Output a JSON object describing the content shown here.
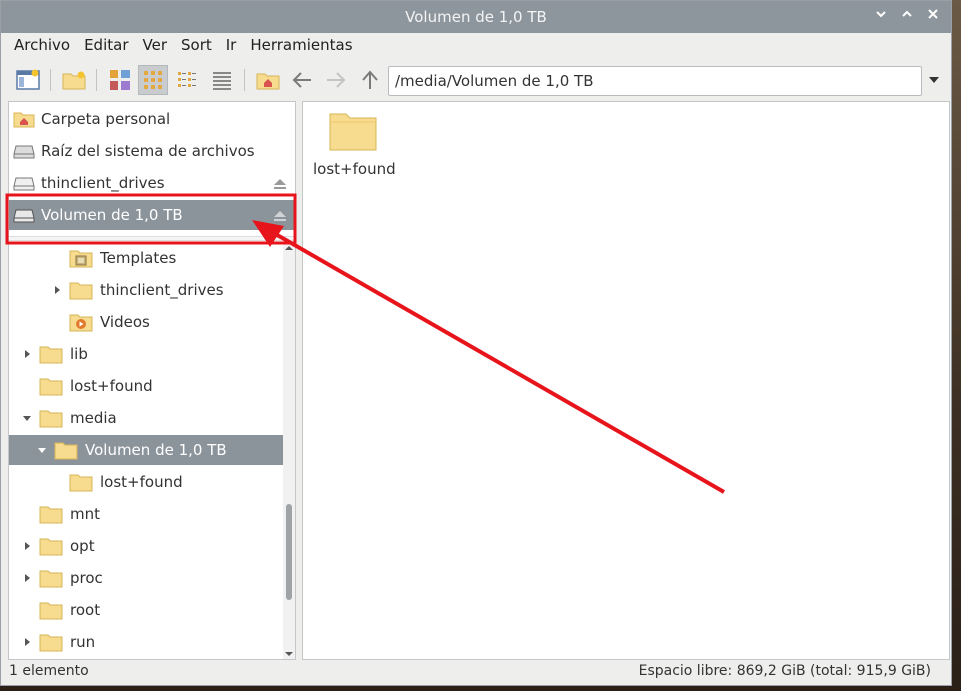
{
  "window": {
    "title": "Volumen de 1,0 TB",
    "controls": [
      "minimize",
      "maximize",
      "close"
    ]
  },
  "menubar": {
    "items": [
      "Archivo",
      "Editar",
      "Ver",
      "Sort",
      "Ir",
      "Herramientas"
    ]
  },
  "toolbar": {
    "path": "/media/Volumen de 1,0 TB",
    "buttons": [
      {
        "icon": "new-window-icon"
      },
      {
        "icon": "new-folder-icon"
      },
      {
        "icon": "thumbnail-view-icon"
      },
      {
        "icon": "icon-view-icon",
        "active": true
      },
      {
        "icon": "compact-view-icon"
      },
      {
        "icon": "list-view-icon"
      },
      {
        "icon": "home-icon"
      },
      {
        "icon": "back-arrow-icon"
      },
      {
        "icon": "forward-arrow-icon"
      },
      {
        "icon": "up-arrow-icon"
      }
    ]
  },
  "places": [
    {
      "label": "Carpeta personal",
      "icon": "home-folder-icon"
    },
    {
      "label": "Raíz del sistema de archivos",
      "icon": "drive-icon"
    },
    {
      "label": "thinclient_drives",
      "icon": "drive-icon",
      "eject": true
    },
    {
      "label": "Volumen de 1,0 TB",
      "icon": "drive-icon",
      "eject": true,
      "selected": true
    }
  ],
  "tree": [
    {
      "label": "Templates",
      "level": 2,
      "expander": "none",
      "icon": "templates-folder-icon"
    },
    {
      "label": "thinclient_drives",
      "level": 2,
      "expander": "collapsed",
      "icon": "folder-icon"
    },
    {
      "label": "Videos",
      "level": 2,
      "expander": "none",
      "icon": "videos-folder-icon"
    },
    {
      "label": "lib",
      "level": 0,
      "expander": "collapsed",
      "icon": "folder-icon"
    },
    {
      "label": "lost+found",
      "level": 0,
      "expander": "none",
      "icon": "folder-icon"
    },
    {
      "label": "media",
      "level": 0,
      "expander": "expanded",
      "icon": "folder-icon"
    },
    {
      "label": "Volumen de 1,0 TB",
      "level": 1,
      "expander": "expanded",
      "icon": "folder-icon",
      "selected": true
    },
    {
      "label": "lost+found",
      "level": 2,
      "expander": "none",
      "icon": "folder-icon"
    },
    {
      "label": "mnt",
      "level": 0,
      "expander": "none",
      "icon": "folder-icon"
    },
    {
      "label": "opt",
      "level": 0,
      "expander": "collapsed",
      "icon": "folder-icon"
    },
    {
      "label": "proc",
      "level": 0,
      "expander": "collapsed",
      "icon": "folder-icon"
    },
    {
      "label": "root",
      "level": 0,
      "expander": "none",
      "icon": "folder-icon"
    },
    {
      "label": "run",
      "level": 0,
      "expander": "collapsed",
      "icon": "folder-icon"
    }
  ],
  "files": [
    {
      "label": "lost+found",
      "icon": "folder-icon"
    }
  ],
  "status": {
    "left": "1 elemento",
    "right": "Espacio libre: 869,2 GiB (total: 915,9 GiB)"
  },
  "annotation": {
    "color": "#e8141b"
  },
  "colors": {
    "titlebar": "#8e969d",
    "selection": "#8c949b",
    "folder": "#f7dc8f"
  }
}
